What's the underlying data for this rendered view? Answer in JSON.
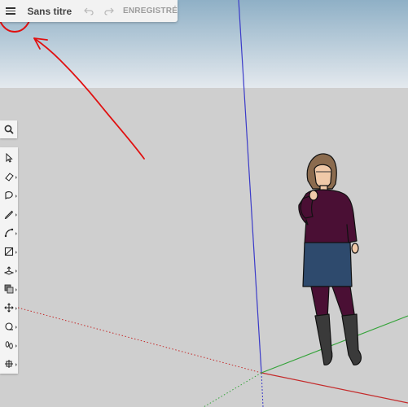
{
  "app": {
    "title": "Sans titre",
    "save_label": "ENREGISTRÉ"
  },
  "icons": {
    "menu": "hamburger-menu-icon",
    "undo": "undo-icon",
    "redo": "redo-icon",
    "search": "search-icon"
  },
  "tools": [
    {
      "name": "select-tool",
      "icon": "cursor-arrow-icon"
    },
    {
      "name": "eraser-tool",
      "icon": "eraser-icon"
    },
    {
      "name": "tag-tool",
      "icon": "tag-icon"
    },
    {
      "name": "line-tool",
      "icon": "pencil-icon"
    },
    {
      "name": "arc-tool",
      "icon": "arc-icon"
    },
    {
      "name": "rectangle-tool",
      "icon": "rectangle-icon"
    },
    {
      "name": "push-pull-tool",
      "icon": "push-pull-icon"
    },
    {
      "name": "offset-tool",
      "icon": "offset-icon"
    },
    {
      "name": "move-tool",
      "icon": "move-icon"
    },
    {
      "name": "tape-measure-tool",
      "icon": "tape-measure-icon"
    },
    {
      "name": "walk-tool",
      "icon": "footprints-icon"
    },
    {
      "name": "section-plane-tool",
      "icon": "section-plane-icon"
    }
  ],
  "colors": {
    "sky_top": "#8fb0c6",
    "sky_bottom": "#dfe6ec",
    "ground": "#cfcfcf",
    "axis_red": "#c42b2b",
    "axis_green": "#35a33a",
    "axis_blue": "#3b3bc9",
    "annotation_red": "#e01010"
  }
}
